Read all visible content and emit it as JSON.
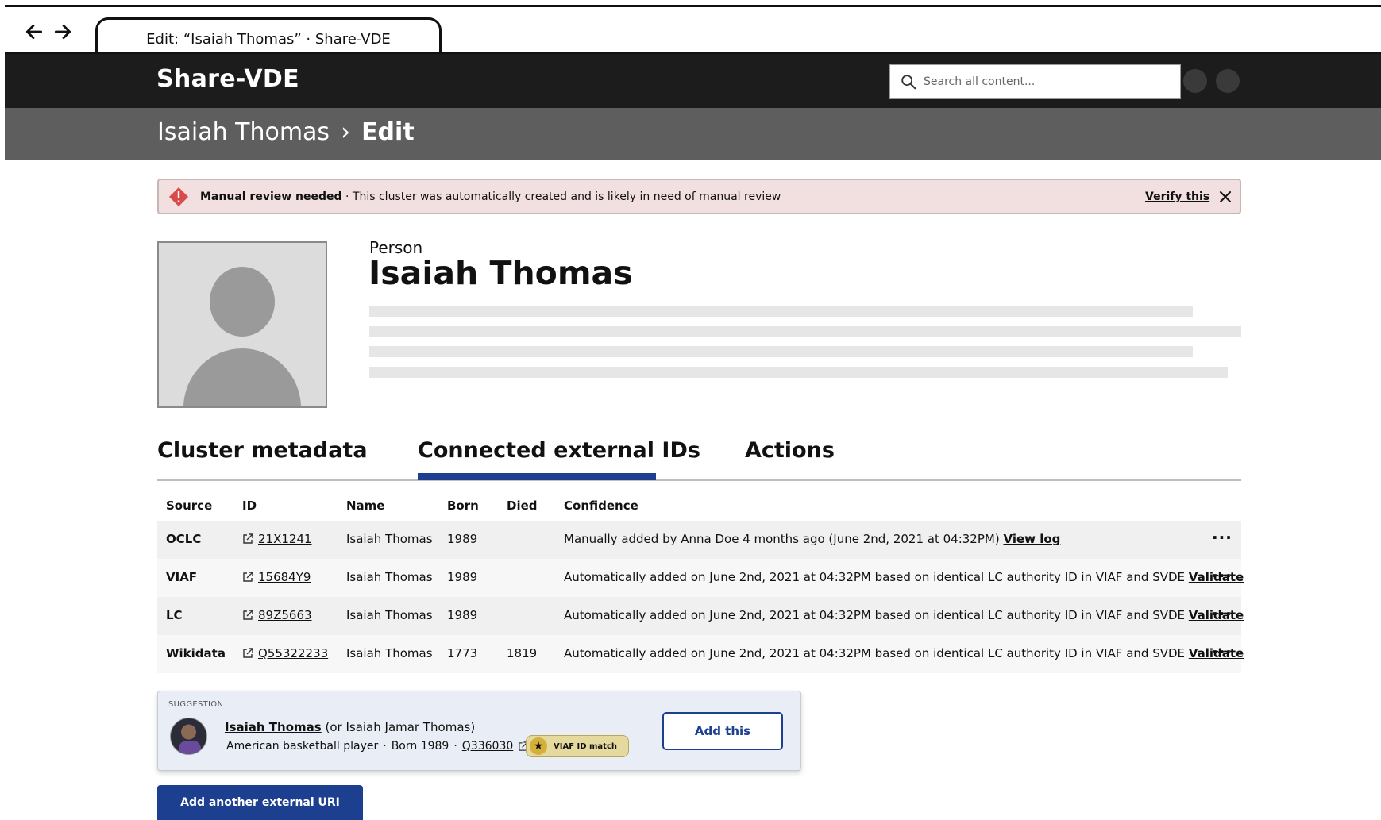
{
  "browser": {
    "tab_title": "Edit: “Isaiah Thomas” · Share-VDE"
  },
  "header": {
    "brand": "Share-VDE",
    "search_placeholder": "Search all content..."
  },
  "breadcrumb": {
    "parent": "Isaiah Thomas",
    "separator": "›",
    "current": "Edit"
  },
  "alert": {
    "title": "Manual review needed",
    "separator": "·",
    "message": "This cluster was automatically created and is likely in need of manual review",
    "action": "Verify this",
    "color": "#f2dfe0"
  },
  "profile": {
    "type": "Person",
    "name": "Isaiah Thomas"
  },
  "tabs": [
    {
      "label": "Cluster metadata"
    },
    {
      "label": "Connected external IDs"
    },
    {
      "label": "Actions"
    }
  ],
  "active_tab": "Connected external IDs",
  "table": {
    "headers": [
      "Source",
      "ID",
      "Name",
      "Born",
      "Died",
      "Confidence"
    ],
    "rows": [
      {
        "source": "OCLC",
        "id": "21X1241",
        "name": "Isaiah Thomas",
        "born": "1989",
        "died": "",
        "confidence": "Manually added by Anna Doe 4 months ago (June 2nd, 2021 at 04:32PM)",
        "link": "View log"
      },
      {
        "source": "VIAF",
        "id": "15684Y9",
        "name": "Isaiah Thomas",
        "born": "1989",
        "died": "",
        "confidence": "Automatically added on June 2nd, 2021 at 04:32PM based on identical LC authority ID in VIAF and SVDE",
        "link": "Validate"
      },
      {
        "source": "LC",
        "id": "89Z5663",
        "name": "Isaiah Thomas",
        "born": "1989",
        "died": "",
        "confidence": "Automatically added on June 2nd, 2021 at 04:32PM based on identical LC authority ID in VIAF and SVDE",
        "link": "Validate"
      },
      {
        "source": "Wikidata",
        "id": "Q55322233",
        "name": "Isaiah Thomas",
        "born": "1773",
        "died": "1819",
        "confidence": "Automatically added on June 2nd, 2021 at 04:32PM based on identical LC authority ID in VIAF and SVDE",
        "link": "Validate"
      }
    ],
    "more_label": "···"
  },
  "suggestion": {
    "label": "SUGGESTION",
    "name": "Isaiah Thomas",
    "alias": "(or Isaiah Jamar Thomas)",
    "description": "American basketball player",
    "born": "Born 1989",
    "sep": "·",
    "id": "Q336030",
    "badge": "VIAF ID match",
    "badge_icon": "★",
    "add_label": "Add this"
  },
  "add_another_label": "Add another external URI",
  "colors": {
    "accent": "#1d3f8f",
    "header_bg": "#1c1c1c",
    "crumb_bg": "#5e5e5e"
  }
}
